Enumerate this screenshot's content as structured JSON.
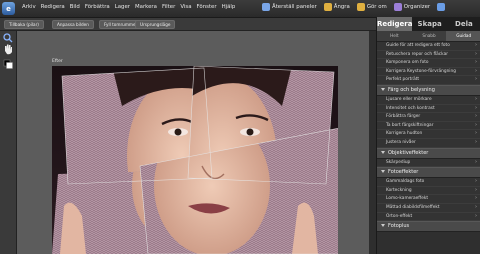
{
  "app": {
    "logo_letter": "e"
  },
  "menubar": {
    "items": [
      "Arkiv",
      "Redigera",
      "Bild",
      "Förbättra",
      "Lager",
      "Markera",
      "Filter",
      "Visa",
      "Fönster",
      "Hjälp"
    ],
    "right": [
      {
        "label": "Återställ paneler",
        "icon": "reset-panels-icon"
      },
      {
        "label": "Ångra",
        "icon": "undo-icon"
      },
      {
        "label": "Gör om",
        "icon": "redo-icon"
      },
      {
        "label": "Organizer",
        "icon": "organizer-icon"
      },
      {
        "label": "",
        "icon": "home-icon"
      }
    ]
  },
  "options_bar": {
    "buttons": [
      "Tillbaka (pilar)",
      "Anpassa bilden",
      "Fyll tomrummet",
      "Ursprungsläge"
    ]
  },
  "document": {
    "label": "Efter"
  },
  "panel": {
    "tabs": [
      {
        "label": "Redigera",
        "active": true
      },
      {
        "label": "Skapa",
        "active": false
      },
      {
        "label": "Dela",
        "active": false
      }
    ],
    "subtabs": [
      {
        "label": "Helt",
        "active": false
      },
      {
        "label": "Snabb",
        "active": false
      },
      {
        "label": "Guidad",
        "active": true
      }
    ],
    "sections": [
      {
        "title": "",
        "items": [
          "Guide för att redigera ett foto",
          "Retuschera repor och fläckar",
          "Komponera om foto",
          "Korrigera Keystone-förvrängning",
          "Perfekt porträtt"
        ]
      },
      {
        "title": "Färg och belysning",
        "items": [
          "Ljusare eller mörkare",
          "Intensitet och kontrast",
          "Förbättra färger",
          "Ta bort färgskiftningar",
          "Korrigera hudton",
          "Justera nivåer"
        ]
      },
      {
        "title": "Objektiveffekter",
        "items": [
          "Skärpediup"
        ]
      },
      {
        "title": "Fotoeffekter",
        "items": [
          "Gammaldags foto",
          "Korteckning",
          "Lomo-kameraeffekt",
          "Mättad diabildsfilmeffekt",
          "Orton-effekt"
        ]
      },
      {
        "title": "Fotoplus",
        "items": []
      }
    ]
  },
  "colors": {
    "accent": "#2d5c9e",
    "panel_active_tab": "#6b6b6b"
  }
}
